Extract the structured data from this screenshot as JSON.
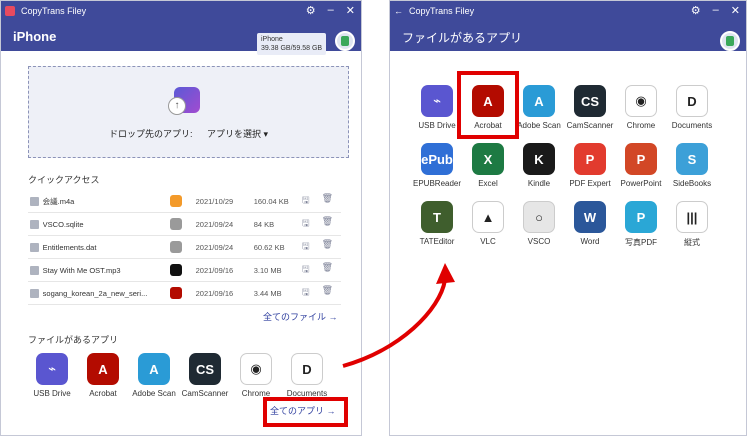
{
  "left": {
    "app_name": "CopyTrans Filey",
    "header_title": "iPhone",
    "device_name": "iPhone",
    "device_storage": "39.38 GB/59.58 GB",
    "drop_label": "ドロップ先のアプリ:",
    "drop_select": "アプリを選択",
    "quick_access_title": "クイックアクセス",
    "files": [
      {
        "name": "会議.m4a",
        "date": "2021/10/29",
        "size": "160.04 KB",
        "app_color": "#f39a2a"
      },
      {
        "name": "VSCO.sqlite",
        "date": "2021/09/24",
        "size": "84 KB",
        "app_color": "#9a9a9a"
      },
      {
        "name": "Entitlements.dat",
        "date": "2021/09/24",
        "size": "60.62 KB",
        "app_color": "#9a9a9a"
      },
      {
        "name": "Stay With Me OST.mp3",
        "date": "2021/09/16",
        "size": "3.10 MB",
        "app_color": "#111111"
      },
      {
        "name": "sogang_korean_2a_new_seri...",
        "date": "2021/09/16",
        "size": "3.44 MB",
        "app_color": "#b30b00"
      }
    ],
    "all_files_link": "全てのファイル →",
    "apps_title": "ファイルがあるアプリ",
    "apps": [
      {
        "label": "USB Drive",
        "color": "#5a56d0",
        "glyph": "⌁"
      },
      {
        "label": "Acrobat",
        "color": "#b30b00",
        "glyph": "A"
      },
      {
        "label": "Adobe Scan",
        "color": "#2a9bd6",
        "glyph": "A"
      },
      {
        "label": "CamScanner",
        "color": "#1f2a33",
        "glyph": "CS"
      },
      {
        "label": "Chrome",
        "color": "#ffffff",
        "glyph": "◉"
      },
      {
        "label": "Documents",
        "color": "#ffffff",
        "glyph": "D"
      }
    ],
    "all_apps_link": "全てのアプリ →"
  },
  "right": {
    "app_name": "CopyTrans Filey",
    "header_title": "ファイルがあるアプリ",
    "apps": [
      {
        "label": "USB Drive",
        "color": "#5a56d0",
        "glyph": "⌁"
      },
      {
        "label": "Acrobat",
        "color": "#b30b00",
        "glyph": "A"
      },
      {
        "label": "Adobe Scan",
        "color": "#2a9bd6",
        "glyph": "A"
      },
      {
        "label": "CamScanner",
        "color": "#1f2a33",
        "glyph": "CS"
      },
      {
        "label": "Chrome",
        "color": "#ffffff",
        "glyph": "◉"
      },
      {
        "label": "Documents",
        "color": "#ffffff",
        "glyph": "D"
      },
      {
        "label": "EPUBReader",
        "color": "#2f6fd6",
        "glyph": "ePub"
      },
      {
        "label": "Excel",
        "color": "#1d7a43",
        "glyph": "X"
      },
      {
        "label": "Kindle",
        "color": "#1a1a1a",
        "glyph": "K"
      },
      {
        "label": "PDF Expert",
        "color": "#e23b2e",
        "glyph": "P"
      },
      {
        "label": "PowerPoint",
        "color": "#d24726",
        "glyph": "P"
      },
      {
        "label": "SideBooks",
        "color": "#3ca0d8",
        "glyph": "S"
      },
      {
        "label": "TATEditor",
        "color": "#3f5e2d",
        "glyph": "T"
      },
      {
        "label": "VLC",
        "color": "#ffffff",
        "glyph": "▲"
      },
      {
        "label": "VSCO",
        "color": "#e6e6e6",
        "glyph": "○"
      },
      {
        "label": "Word",
        "color": "#2b579a",
        "glyph": "W"
      },
      {
        "label": "写真PDF",
        "color": "#2aa7d6",
        "glyph": "P"
      },
      {
        "label": "縦式",
        "color": "#ffffff",
        "glyph": "|||"
      }
    ]
  },
  "colors": {
    "header": "#3f4a9a",
    "highlight": "#e00000",
    "link": "#2f3f9f"
  }
}
